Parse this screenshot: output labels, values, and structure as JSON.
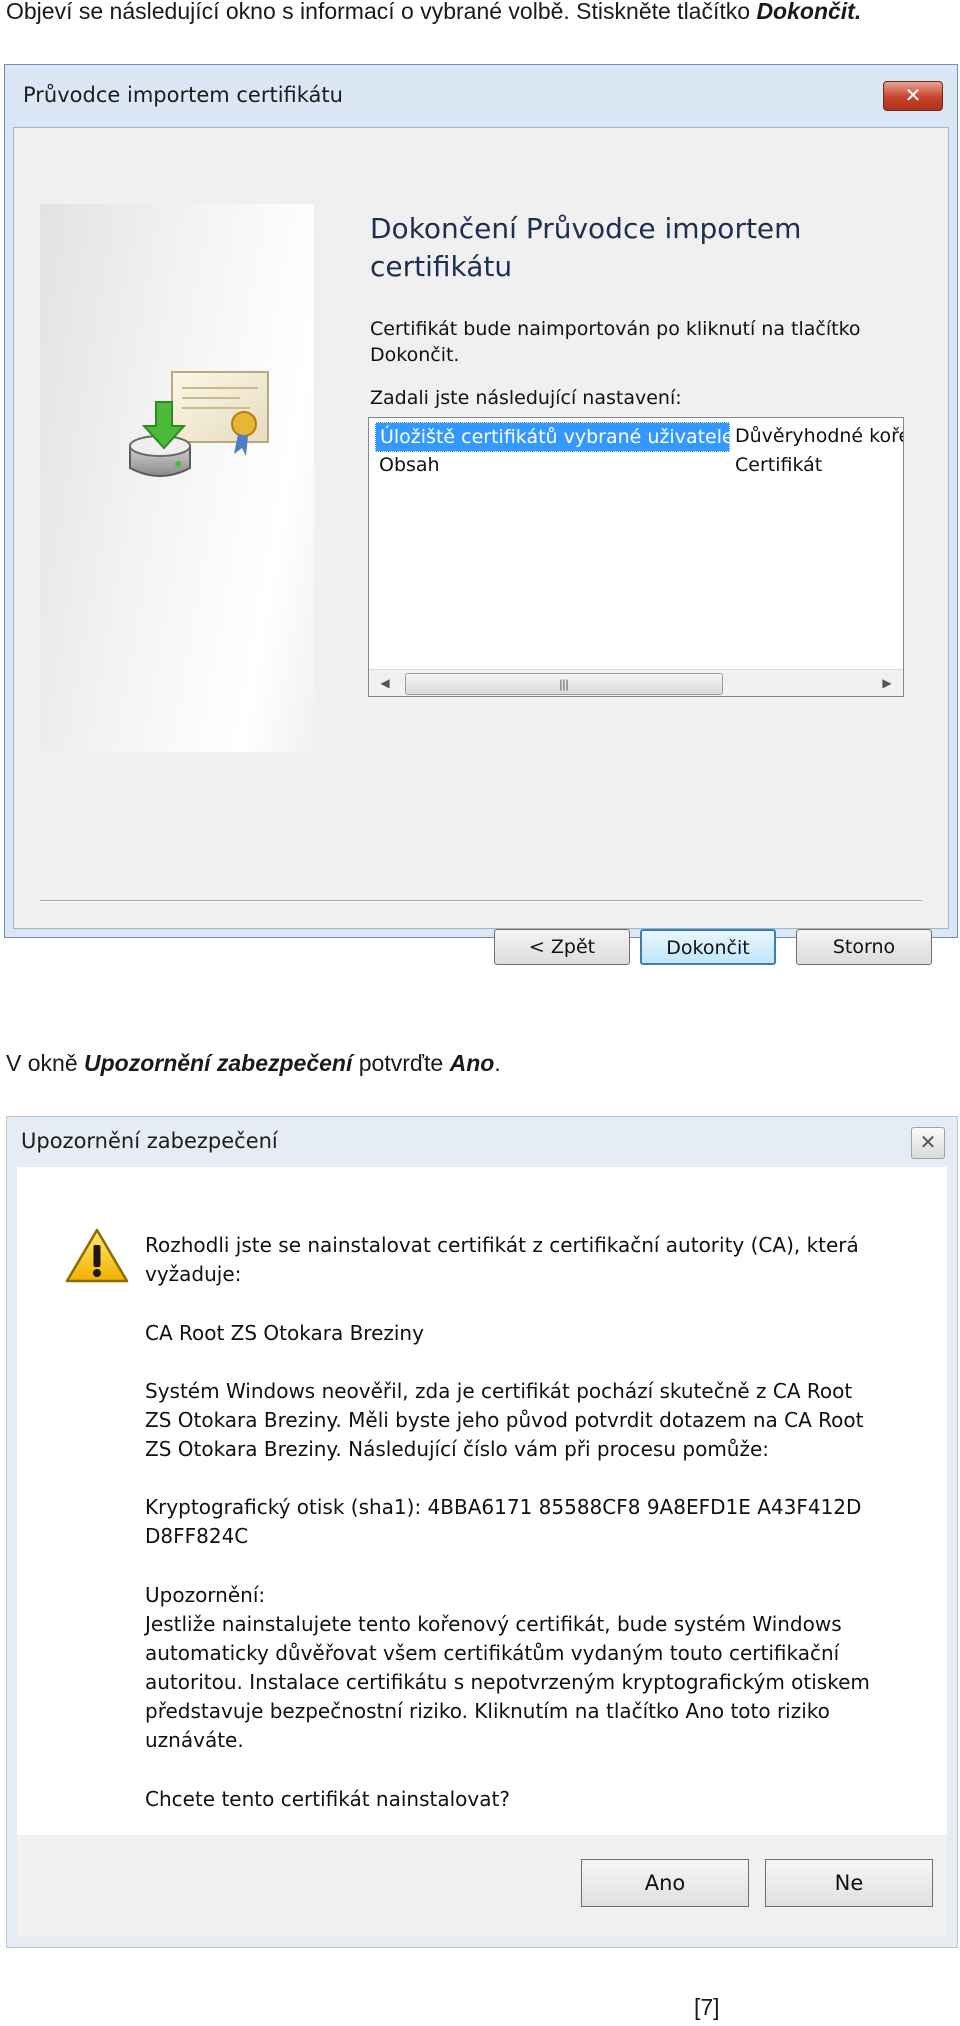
{
  "caption1": {
    "text": "Objeví se následující okno s informací o vybrané volbě. Stiskněte tlačítko ",
    "emph": "Dokončit",
    "end": "."
  },
  "wizard": {
    "title": "Průvodce importem certifikátu",
    "close_glyph": "✕",
    "heading_line1": "Dokončení Průvodce importem",
    "heading_line2": "certifikátu",
    "info_line1": "Certifikát bude naimportován po kliknutí na tlačítko",
    "info_line2": "Dokončit.",
    "settings_label": "Zadali jste následující nastavení:",
    "rows": [
      {
        "name": "Úložiště certifikátů vybrané uživatelem",
        "value": "Důvěryhodné kořenové certifikační autority"
      },
      {
        "name": "Obsah",
        "value": "Certifikát"
      }
    ],
    "scroll_left": "◀",
    "scroll_right": "▶",
    "scroll_grip": "|||",
    "back_label": "< Zpět",
    "finish_label": "Dokončit",
    "cancel_label": "Storno"
  },
  "caption2": {
    "pre": "V okně ",
    "emph": "Upozornění zabezpečení",
    "mid": " potvrďte ",
    "emph2": "Ano",
    "end": "."
  },
  "security": {
    "title": "Upozornění zabezpečení",
    "close_glyph": "✕",
    "p1_line1": "Rozhodli jste se nainstalovat certifikát z certifikační autority (CA), která",
    "p1_line2": "vyžaduje:",
    "ca_name": "CA Root ZS Otokara Breziny",
    "p3_line1": "Systém Windows neověřil, zda je certifikát pochází skutečně z CA Root",
    "p3_line2": "ZS Otokara Breziny. Měli byste jeho původ potvrdit dotazem na CA Root",
    "p3_line3": "ZS Otokara Breziny. Následující číslo vám při procesu pomůže:",
    "thumb_line1": "Kryptografický otisk (sha1): 4BBA6171 85588CF8 9A8EFD1E A43F412D",
    "thumb_line2": "D8FF824C",
    "warn_label": "Upozornění:",
    "w_line1": "Jestliže nainstalujete tento kořenový certifikát, bude systém Windows",
    "w_line2": "automaticky důvěřovat všem certifikátům vydaným touto certifikační",
    "w_line3": "autoritou. Instalace certifikátu s nepotvrzeným kryptografickým otiskem",
    "w_line4": "představuje bezpečnostní riziko. Kliknutím na tlačítko Ano toto riziko",
    "w_line5": "uznáváte.",
    "question": "Chcete tento certifikát nainstalovat?",
    "yes_label": "Ano",
    "no_label": "Ne"
  },
  "page_number": "[7]"
}
